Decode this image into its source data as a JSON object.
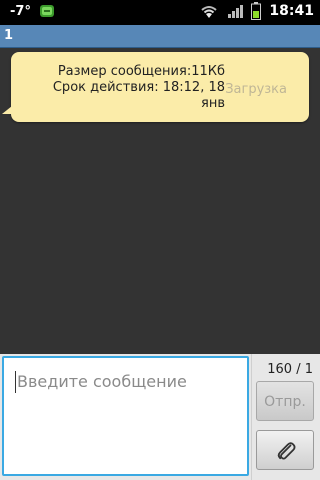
{
  "status_bar": {
    "temperature": "-7°",
    "time": "18:41",
    "icons": [
      "weather-icon",
      "android-notification-icon",
      "wifi-icon",
      "signal-icon",
      "battery-icon"
    ]
  },
  "title_bar": {
    "title": "1"
  },
  "message": {
    "line1": "Размер сообщения:11Кб",
    "line2": "Срок действия: 18:12, 18",
    "line3": "янв",
    "download_label": "Загрузка"
  },
  "compose": {
    "placeholder": "Введите сообщение",
    "char_counter": "160 / 1",
    "send_label": "Отпр.",
    "attach_icon": "paperclip-icon"
  },
  "colors": {
    "title_bar": "#5787b7",
    "bubble": "#fbeca9",
    "background": "#333333",
    "focus_border": "#3aa9e3"
  }
}
